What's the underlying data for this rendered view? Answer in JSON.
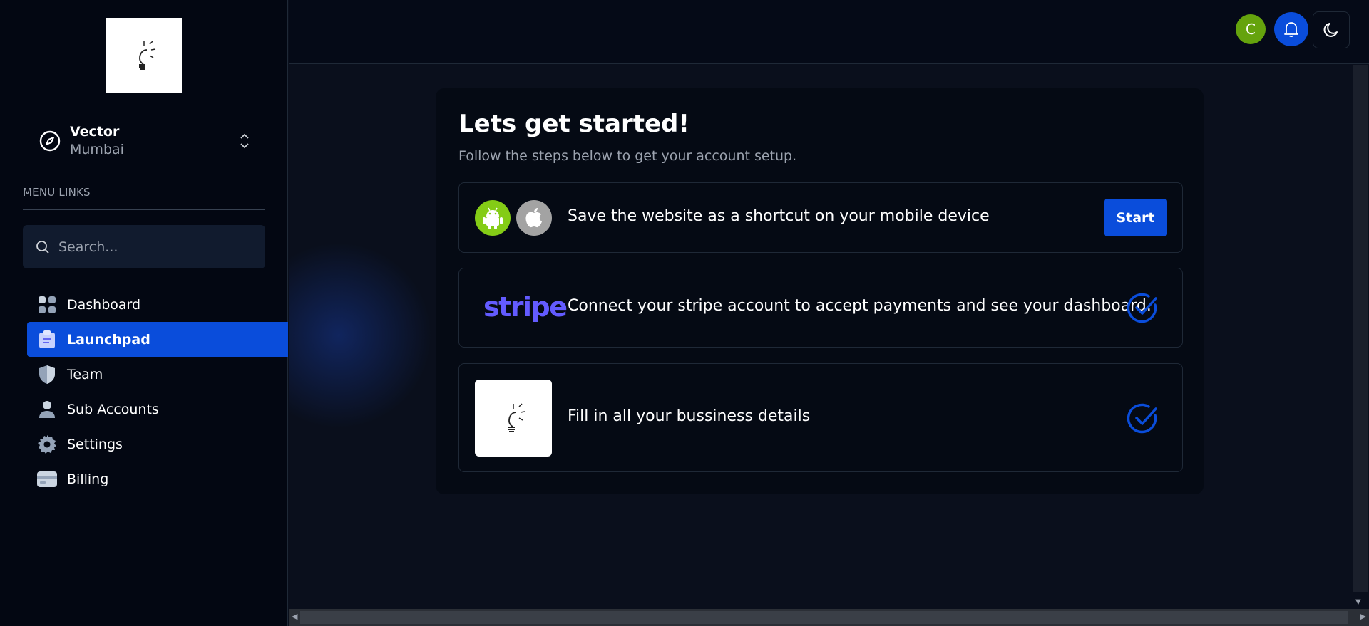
{
  "sidebar": {
    "account": {
      "name": "Vector",
      "location": "Mumbai"
    },
    "menu_title": "MENU LINKS",
    "search_placeholder": "Search...",
    "items": [
      {
        "label": "Dashboard",
        "icon": "dashboard-icon",
        "active": false
      },
      {
        "label": "Launchpad",
        "icon": "clipboard-icon",
        "active": true
      },
      {
        "label": "Team",
        "icon": "shield-icon",
        "active": false
      },
      {
        "label": "Sub Accounts",
        "icon": "person-icon",
        "active": false
      },
      {
        "label": "Settings",
        "icon": "gear-icon",
        "active": false
      },
      {
        "label": "Billing",
        "icon": "card-icon",
        "active": false
      }
    ]
  },
  "topbar": {
    "avatar_initial": "C",
    "colors": {
      "avatar": "#65a30d",
      "accent": "#0a4ddb"
    }
  },
  "main": {
    "title": "Lets get started!",
    "subtitle": "Follow the steps below to get your account setup.",
    "steps": [
      {
        "label": "Save the website as a shortcut on your mobile device",
        "action": "Start",
        "icons": [
          "android-icon",
          "apple-icon"
        ]
      },
      {
        "logo_text": "stripe",
        "label": "Connect your stripe account to accept payments and see your dashboard.",
        "status": "check-circle-icon"
      },
      {
        "label": "Fill in all your bussiness details",
        "status": "check-circle-icon"
      }
    ]
  }
}
